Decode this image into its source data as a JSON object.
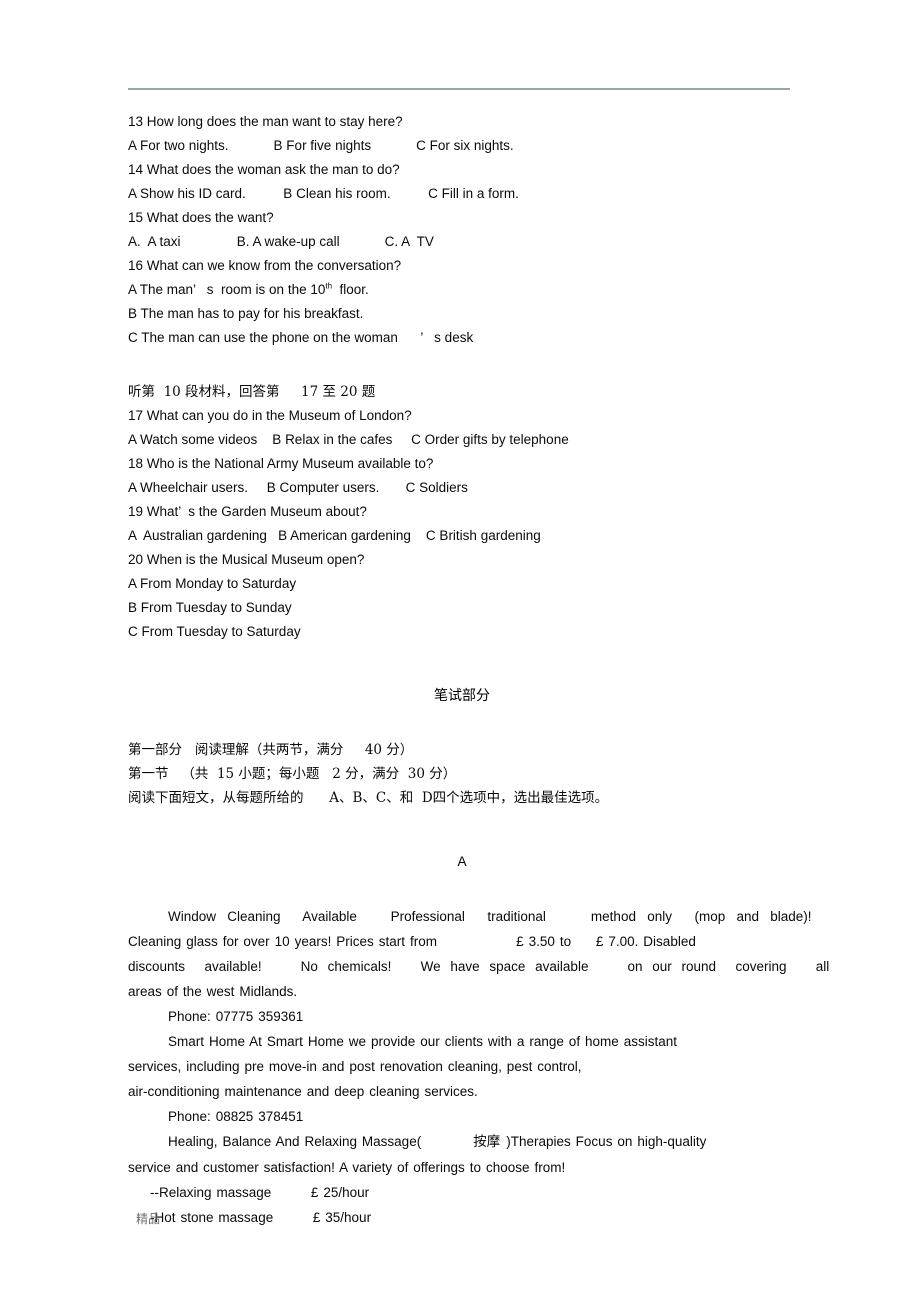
{
  "document": {
    "footer_watermark": "精品",
    "rule_color": "#9aa5a5"
  },
  "listening": {
    "q13": {
      "stem": "13 How long does the man want to stay here?",
      "options": "A For two nights.            B For five nights            C For six nights."
    },
    "q14": {
      "stem": "14 What does the woman ask the man to do?",
      "options": "A Show his ID card.          B Clean his room.          C Fill in a form."
    },
    "q15": {
      "stem": "15 What does the want?",
      "options": "A.  A taxi               B. A wake-up call            C. A  TV"
    },
    "q16": {
      "stem": "16 What can we know from the conversation?",
      "option_a_pre": "A The man’   s  room is on the 10",
      "option_a_sup": "th",
      "option_a_post": "  floor.",
      "option_b": "B The man has to pay for his breakfast.",
      "option_c": "C The man can use the phone on the woman      ’   s desk"
    },
    "section_header_10": "听第  10 段材料，回答第     17 至 20 题",
    "q17": {
      "stem": "17 What can you do in the Museum of London?",
      "options": "A Watch some videos    B Relax in the cafes     C Order gifts by telephone"
    },
    "q18": {
      "stem": "18 Who is the National Army Museum available to?",
      "options": "A Wheelchair users.     B Computer users.       C Soldiers"
    },
    "q19": {
      "stem": "19 What’  s the Garden Museum about?",
      "options": "A  Australian gardening   B American gardening    C British gardening"
    },
    "q20": {
      "stem": "20 When is the Musical Museum open?",
      "option_a": "A From Monday to Saturday",
      "option_b": "B From Tuesday to Sunday",
      "option_c": "C From Tuesday to Saturday"
    }
  },
  "written": {
    "title": "笔试部分",
    "part_one": "第一部分   阅读理解（共两节，满分     40 分）",
    "section_one": "第一节   （共  15 小题；每小题   2 分，满分  30 分）",
    "instruction": "阅读下面短文，从每题所给的      A、B、C、和  D四个选项中，选出最佳选项。",
    "passage_label": "A"
  },
  "passage_a": {
    "window_cleaning": {
      "line1": "Window Cleaning  Available   Professional  traditional    method only  (mop and blade)!",
      "line2": "Cleaning glass for over 10 years! Prices start from                £ 3.50 to     £ 7.00. Disabled",
      "line3": "discounts  available!    No chemicals!   We have space available    on our round  covering   all",
      "line4": "areas of the west Midlands.",
      "phone": "Phone: 07775 359361"
    },
    "smart_home": {
      "line1": "Smart Home At Smart Home we provide our clients with a range of home assistant",
      "line2": "services, including pre move-in and post renovation cleaning, pest control,",
      "line3": "air-conditioning maintenance and deep cleaning services.",
      "phone": "Phone: 08825 378451"
    },
    "massage": {
      "line1_pre": "Healing, Balance And Relaxing Massage(",
      "line1_cn": "按摩",
      "line1_post": ")Therapies Focus on high-quality",
      "line2": "service and customer satisfaction! A variety of offerings to choose from!",
      "price1": "--Relaxing massage        £ 25/hour",
      "price2": "-Hot stone massage        £ 35/hour"
    }
  }
}
